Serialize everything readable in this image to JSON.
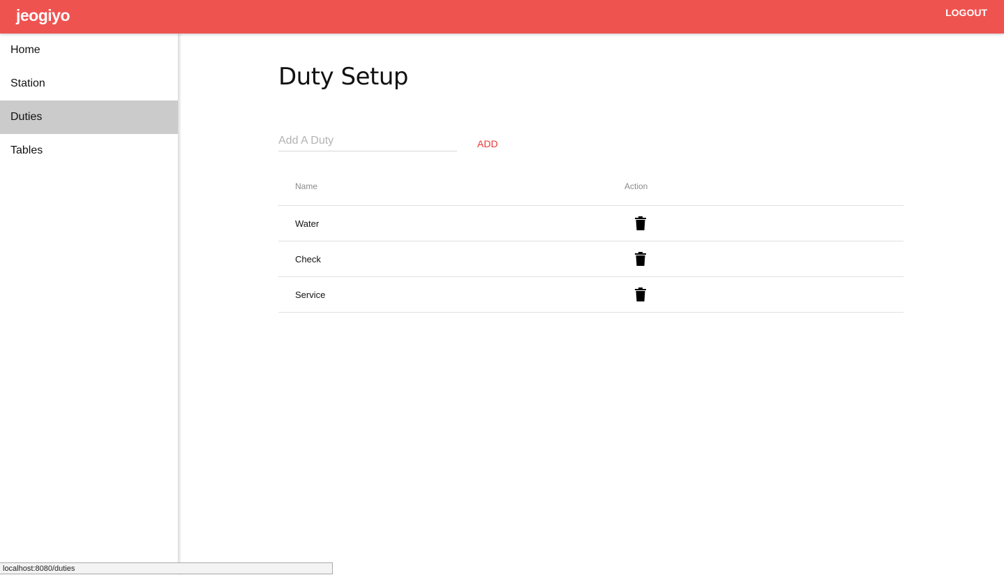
{
  "header": {
    "brand": "jeogiyo",
    "logout_label": "LOGOUT",
    "accent_color": "#ef5350"
  },
  "sidebar": {
    "items": [
      {
        "label": "Home",
        "active": false
      },
      {
        "label": "Station",
        "active": false
      },
      {
        "label": "Duties",
        "active": true
      },
      {
        "label": "Tables",
        "active": false
      }
    ]
  },
  "main": {
    "title": "Duty Setup",
    "input": {
      "placeholder": "Add A Duty",
      "value": ""
    },
    "add_label": "ADD",
    "table": {
      "columns": [
        "Name",
        "Action"
      ],
      "rows": [
        {
          "name": "Water",
          "action_icon": "trash-icon"
        },
        {
          "name": "Check",
          "action_icon": "trash-icon"
        },
        {
          "name": "Service",
          "action_icon": "trash-icon"
        }
      ]
    }
  },
  "status_bar": {
    "url": "localhost:8080/duties"
  }
}
